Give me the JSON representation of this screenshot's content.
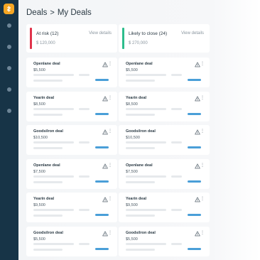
{
  "header": {
    "parent": "Deals",
    "separator": ">",
    "title": "My Deals"
  },
  "colors": {
    "sidebar": "#173447",
    "logo": "#f5a623",
    "at_risk": "#e0334b",
    "likely": "#2dbd8c",
    "progress": "#4a9fd8"
  },
  "sidebar": {
    "logo_icon": "dollar-icon",
    "item_count": 5
  },
  "summaries": [
    {
      "label": "At risk (12)",
      "amount": "$ 120,000",
      "link": "View details",
      "accent": "#e0334b"
    },
    {
      "label": "Likely to close (24)",
      "amount": "$ 270,000",
      "link": "View details",
      "accent": "#2dbd8c"
    }
  ],
  "deals": [
    {
      "name": "Openlane deal",
      "value": "$5,500"
    },
    {
      "name": "Openlane deal",
      "value": "$5,500"
    },
    {
      "name": "Yearin deal",
      "value": "$8,500"
    },
    {
      "name": "Yearin deal",
      "value": "$8,500"
    },
    {
      "name": "Goodsilron deal",
      "value": "$10,500"
    },
    {
      "name": "Goodsilron deal",
      "value": "$10,500"
    },
    {
      "name": "Openlane deal",
      "value": "$7,500"
    },
    {
      "name": "Openlane deal",
      "value": "$7,500"
    },
    {
      "name": "Yearin deal",
      "value": "$9,500"
    },
    {
      "name": "Yearin deal",
      "value": "$9,500"
    },
    {
      "name": "Goodsilron deal",
      "value": "$5,500"
    },
    {
      "name": "Goodsilron deal",
      "value": "$5,500"
    }
  ]
}
